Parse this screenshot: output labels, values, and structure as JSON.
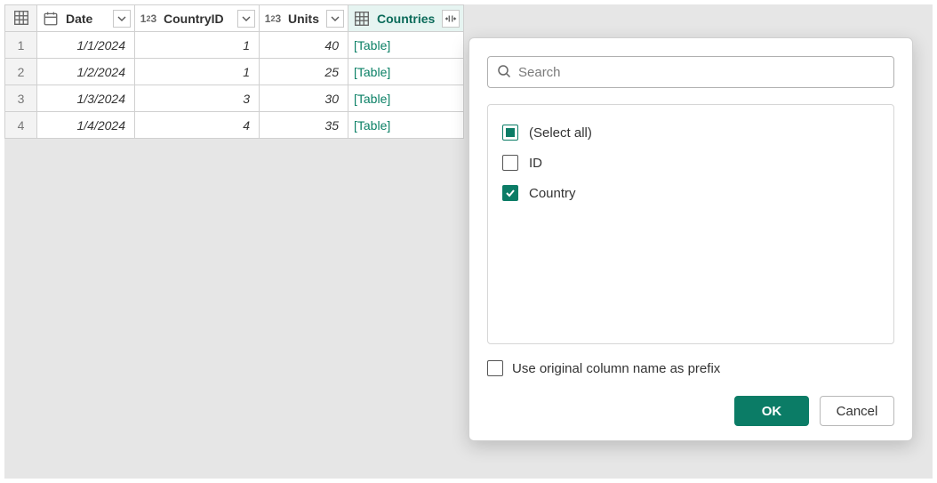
{
  "table": {
    "columns": [
      {
        "name": "Date",
        "type": "date"
      },
      {
        "name": "CountryID",
        "type": "number"
      },
      {
        "name": "Units",
        "type": "number"
      },
      {
        "name": "Countries",
        "type": "table",
        "selected": true
      }
    ],
    "rows": [
      {
        "date": "1/1/2024",
        "country_id": "1",
        "units": "40",
        "countries": "[Table]"
      },
      {
        "date": "1/2/2024",
        "country_id": "1",
        "units": "25",
        "countries": "[Table]"
      },
      {
        "date": "1/3/2024",
        "country_id": "3",
        "units": "30",
        "countries": "[Table]"
      },
      {
        "date": "1/4/2024",
        "country_id": "4",
        "units": "35",
        "countries": "[Table]"
      }
    ]
  },
  "popup": {
    "search_placeholder": "Search",
    "options": {
      "select_all": "(Select all)",
      "id": "ID",
      "country": "Country"
    },
    "prefix_label": "Use original column name as prefix",
    "ok_label": "OK",
    "cancel_label": "Cancel"
  }
}
